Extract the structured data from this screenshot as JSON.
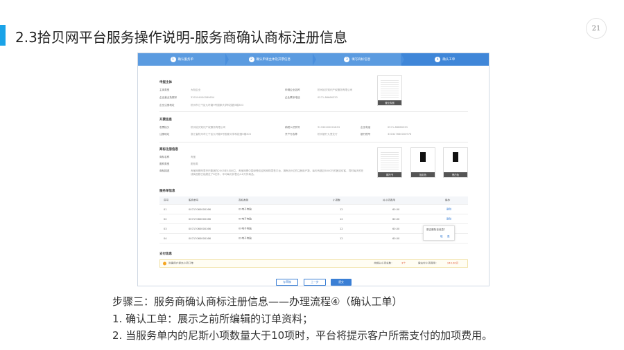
{
  "slide": {
    "title": "2.3拾贝网平台服务操作说明-服务商确认商标注册信息",
    "page_number": "21",
    "accent_color": "#1aa3e8"
  },
  "steps": [
    {
      "num": "1",
      "label": "确认服务单"
    },
    {
      "num": "2",
      "label": "确认申请主体及开票信息"
    },
    {
      "num": "3",
      "label": "填写商标信息"
    },
    {
      "num": "4",
      "label": "确认工单"
    }
  ],
  "applicant": {
    "section_title": "申报主体",
    "subject_type_label": "主体类型",
    "subject_type_value": "大陆企业",
    "license_label": "企业营业执照号",
    "license_value": "330104000089654",
    "address_label": "企业注册地址",
    "address_value": "杭州市江干区九环路9号国家大学科技园5幢303",
    "company_label": "申请企业名称",
    "company_value": "杭州拾贝知识产权服务有限公司",
    "phone_label": "企业联系电话",
    "phone_value": "0571-86666333",
    "license_image_caption": "营业执照"
  },
  "invoice": {
    "section_title": "开票信息",
    "title_label": "发票抬头",
    "title_value": "杭州拾贝知识产权服务有限公司",
    "reg_addr_label": "注册地址",
    "reg_addr_value": "浙江省杭州市江干区九环路9号国家大学科技园5幢303",
    "taxpayer_label": "纳税人识别号",
    "taxpayer_value": "91330200001833",
    "bank_label": "开户行名称",
    "bank_value": "杭州银行九堡支行",
    "tel_label": "企业电话",
    "tel_value": "0571-86666333",
    "account_label": "银行账号",
    "account_value": "330327660000976"
  },
  "trademark": {
    "section_title": "商标注册信息",
    "name_label": "商标名称",
    "name_value": "淘宝",
    "type_label": "图样类型",
    "type_value": "图形类",
    "desc_label": "商标描述",
    "desc_value": "淘宝网是阿里巴巴集团在2003年5月创立，淘宝网是中国深受欢迎的网购零售平台，拥有近5亿的注册用户数，每天有超过6000万的固定访客，同时每天的在线商品数已经超过了8亿件，平均每分钟售出4.8万件商品。",
    "images": [
      "委托书",
      "指定色",
      "黑白色"
    ]
  },
  "service": {
    "section_title": "服务单信息",
    "columns": [
      "序号",
      "服务单号",
      "商标类别",
      "小项数",
      "补小项费用",
      "操作"
    ],
    "rows": [
      {
        "seq": "01",
        "order": "00717060000166",
        "category": "09电子电脑",
        "items": "12",
        "fee": "60.00",
        "action": "删除"
      },
      {
        "seq": "02",
        "order": "00717060000166",
        "category": "09电子电脑",
        "items": "12",
        "fee": "60.00",
        "action": "删除"
      },
      {
        "seq": "03",
        "order": "00717060000166",
        "category": "09电子电脑",
        "items": "12",
        "fee": "60.00",
        "action": ""
      },
      {
        "seq": "04",
        "order": "00717060000166",
        "category": "09电子电脑",
        "items": "12",
        "fee": "60.00",
        "action": "删除"
      }
    ],
    "popup": {
      "question": "是否删除该信息？",
      "cancel": "取",
      "ok": "是"
    }
  },
  "payment": {
    "section_title": "支付信息",
    "notice": "尚需用户提交小项订单",
    "total_items_label": "共超出小项总数：",
    "total_items_value": "3个",
    "fee_label": "需支付小项费用：",
    "fee_value": "240.00元"
  },
  "buttons": {
    "save": "存草稿",
    "prev": "上一步",
    "submit": "提交"
  },
  "caption": {
    "heading": "步骤三：服务商确认商标注册信息——办理流程④（确认工单）",
    "item1": "1.   确认工单：展示之前所编辑的订单资料；",
    "item2": "2.   当服务单内的尼斯小项数量大于10项时，平台将提示客户所需支付的加项费用。"
  }
}
